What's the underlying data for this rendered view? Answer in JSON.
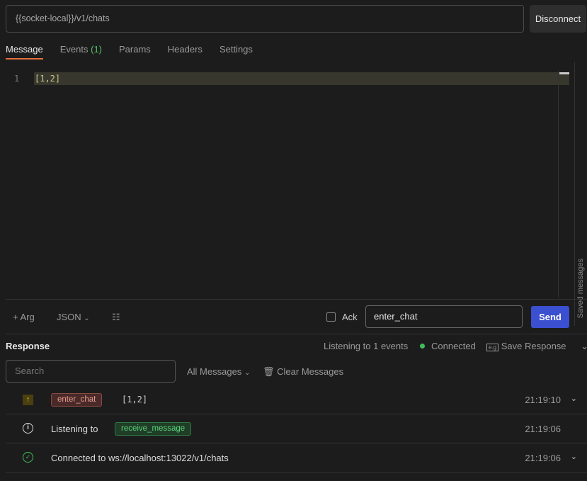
{
  "url": {
    "value": "{{socket-local}}/v1/chats"
  },
  "disconnect_label": "Disconnect",
  "tabs": [
    {
      "label": "Message"
    },
    {
      "label": "Events ",
      "count": "(1)"
    },
    {
      "label": "Params"
    },
    {
      "label": "Headers"
    },
    {
      "label": "Settings"
    }
  ],
  "editor": {
    "line_number": "1",
    "content": "[1,2]"
  },
  "saved_messages_label": "Saved messages",
  "toolbar": {
    "arg_label": "Arg",
    "format_label": "JSON",
    "ack_label": "Ack",
    "ack_checked": false,
    "event_name": "enter_chat",
    "send_label": "Send"
  },
  "response": {
    "title": "Response",
    "listening": "Listening to 1 events",
    "connected": "Connected",
    "save_response": "Save Response",
    "search_placeholder": "Search",
    "filter": "All Messages",
    "clear": "Clear Messages"
  },
  "messages": [
    {
      "icon": "arrow-up-icon",
      "event": "enter_chat",
      "payload": "[1,2]",
      "time": "21:19:10"
    },
    {
      "icon": "info-icon",
      "text": "Listening to",
      "event": "receive_message",
      "time": "21:19:06"
    },
    {
      "icon": "check-circle-icon",
      "text": "Connected to ws://localhost:13022/v1/chats",
      "time": "21:19:06"
    }
  ],
  "colors": {
    "accent": "#e5703e",
    "send": "#3b4fd1",
    "connected": "#3fbf5a"
  }
}
